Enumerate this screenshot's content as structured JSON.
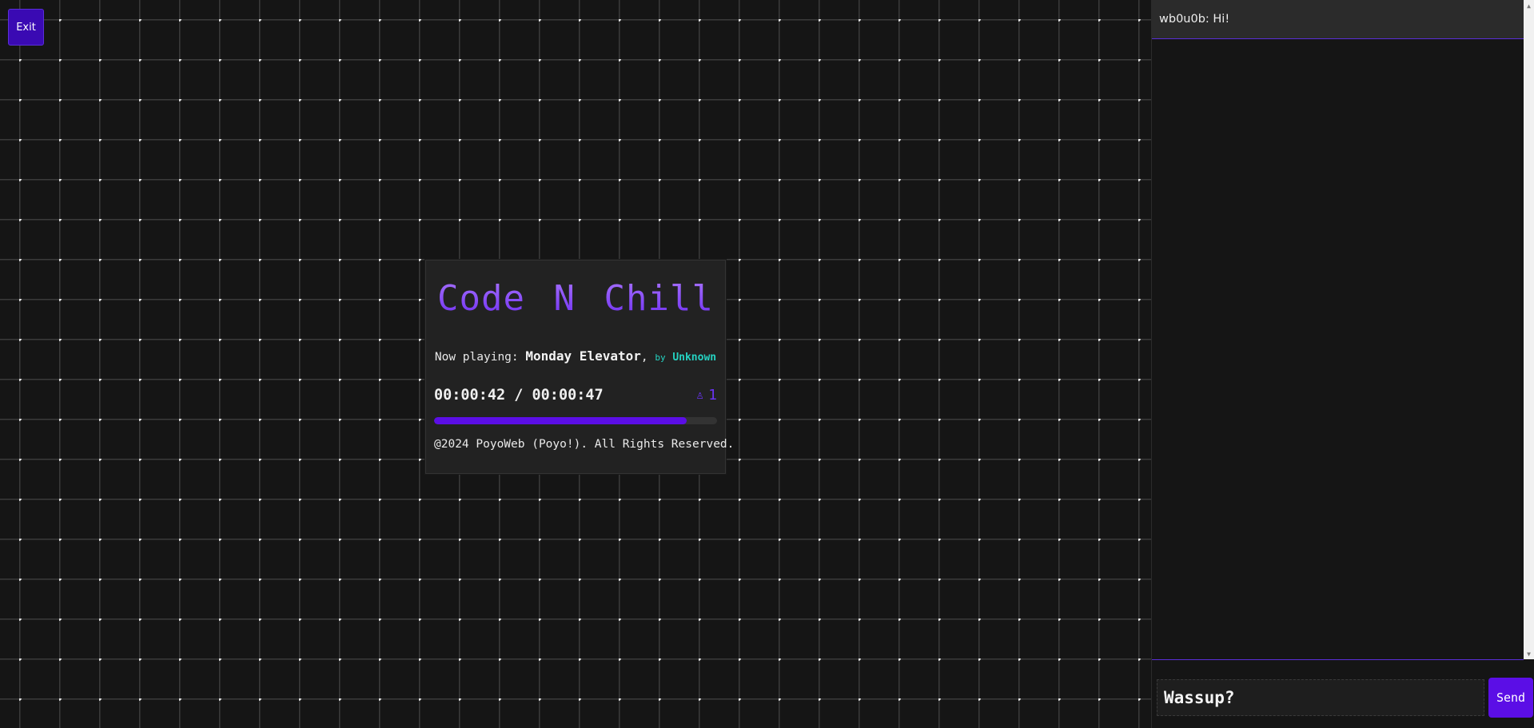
{
  "colors": {
    "accent": "#5b0ee6",
    "exit_button": "#3a0ab3",
    "artist": "#25d3c2",
    "background": "#151515",
    "card": "#222222"
  },
  "exit_label": "Exit",
  "player": {
    "brand_left": "Code",
    "brand_mid": "N",
    "brand_right": "Chill",
    "brand_separator_icon": "diamond-link-icon",
    "now_playing_prefix": "Now playing: ",
    "track_title": "Monday Elevator",
    "by_label": "by",
    "artist": "Unknown",
    "elapsed": "00:00:42",
    "duration": "00:00:47",
    "time_separator": " / ",
    "listener_icon": "person-icon",
    "listener_count": "1",
    "progress_fraction": 0.894,
    "copyright": "@2024 PoyoWeb (Poyo!). All Rights Reserved."
  },
  "chat": {
    "messages": [
      {
        "text": "wb0u0b: Hi!"
      }
    ],
    "input_value": "Wassup?",
    "send_label": "Send"
  }
}
